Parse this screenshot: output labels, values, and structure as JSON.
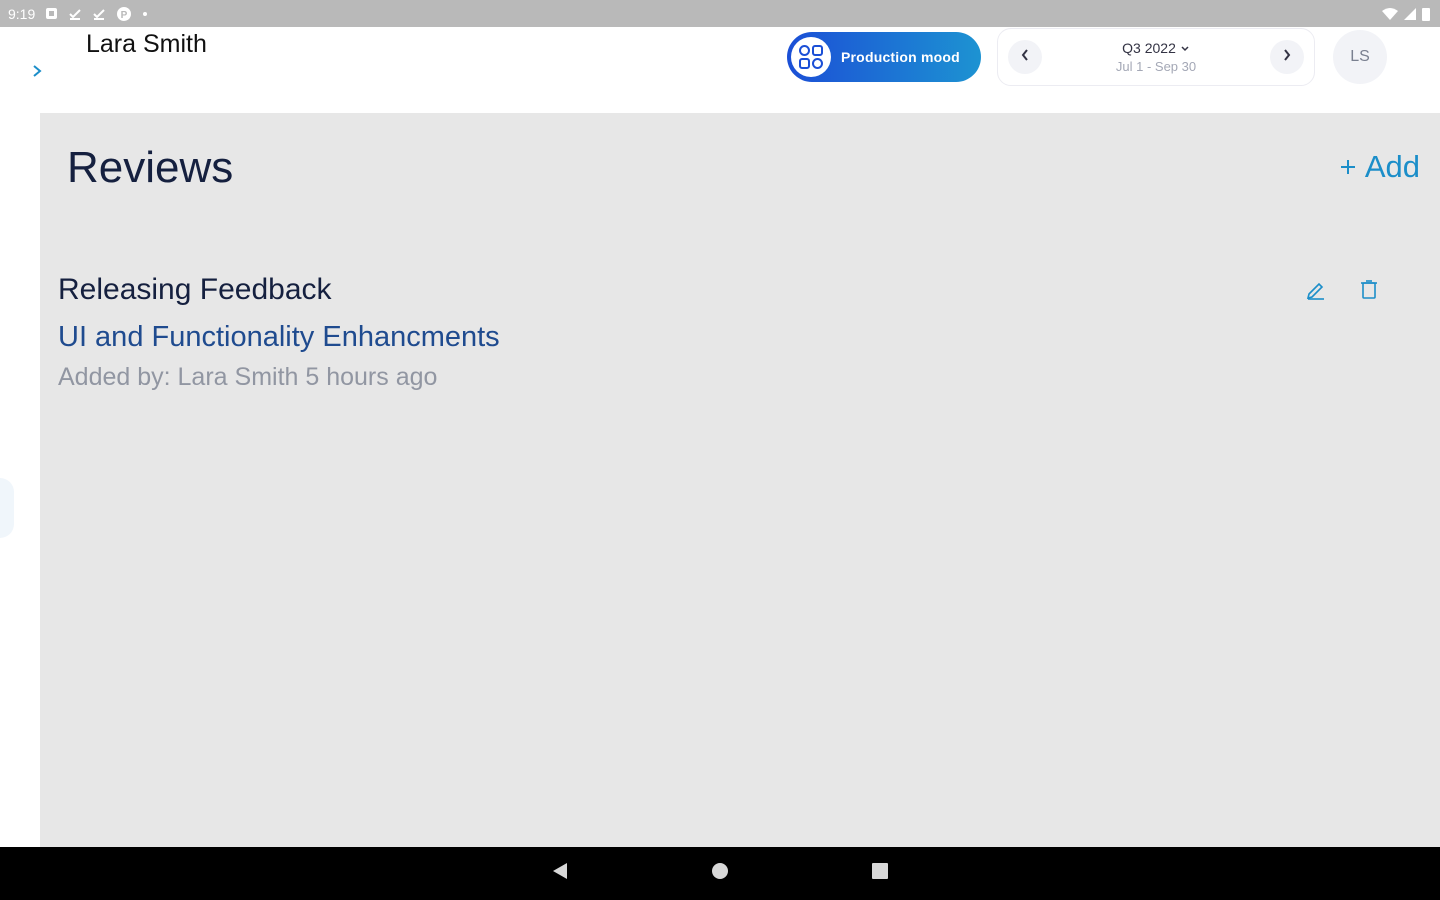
{
  "status_bar": {
    "time": "9:19",
    "notification_icons": [
      "square-notification-icon",
      "task-check-icon",
      "task-check-icon",
      "p-circle-icon",
      "dot-icon"
    ],
    "system_icons": [
      "wifi-icon",
      "signal-icon",
      "battery-icon"
    ]
  },
  "header": {
    "user_name": "Lara Smith",
    "mode_label": "Production mood",
    "period": {
      "title": "Q3 2022",
      "range": "Jul 1 - Sep 30"
    },
    "avatar_initials": "LS"
  },
  "main": {
    "page_title": "Reviews",
    "add_label": "Add",
    "reviews": [
      {
        "title": "Releasing Feedback",
        "subtitle": "UI and Functionality Enhancments",
        "meta": "Added by: Lara Smith 5 hours ago"
      }
    ]
  },
  "colors": {
    "accent": "#1b8ec9",
    "title_text": "#15203f",
    "content_bg": "#e7e7e7",
    "pill_start": "#1b4fd6",
    "pill_end": "#1d93d2"
  }
}
